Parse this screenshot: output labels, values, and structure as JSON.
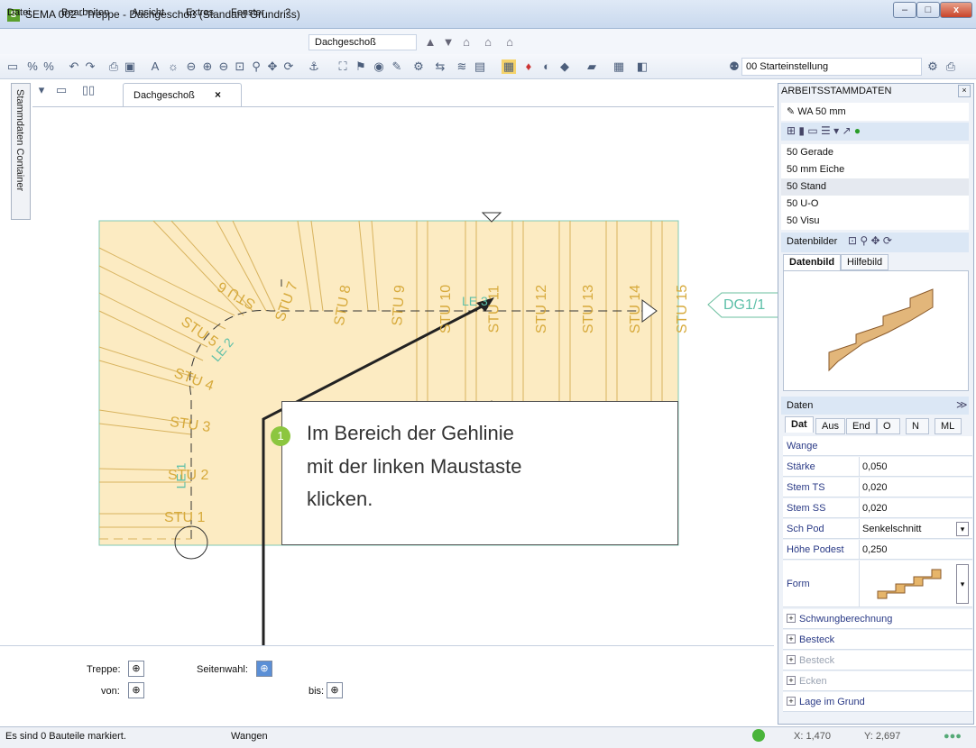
{
  "window": {
    "title": "SEMA  002 - Treppe  - Dachgeschoß (Standard Grundriss)",
    "logo": "S"
  },
  "menu": {
    "items": [
      "Datei",
      "Bearbeiten",
      "Ansicht",
      "Extras",
      "Fenster",
      "?"
    ],
    "level": "Dachgeschoß"
  },
  "toolbar": {
    "preset": "00 Starteinstellung"
  },
  "side_container": "Stammdaten Container",
  "document_tab": "Dachgeschoß",
  "drawing": {
    "steps": [
      "STU 1",
      "STU 2",
      "STU 3",
      "STU 4",
      "STU 5",
      "STU 6",
      "STU 7",
      "STU 8",
      "STU 9",
      "STU 10",
      "STU 11",
      "STU 12",
      "STU 13",
      "STU 14",
      "STU 15"
    ],
    "walk_lines": [
      "LE 1",
      "LE 2",
      "LE 3"
    ],
    "exit_label": "DG1/1"
  },
  "callout": {
    "number": "1",
    "text_lines": [
      "Im Bereich der Gehlinie",
      "mit der linken Maustaste",
      "klicken."
    ]
  },
  "panel": {
    "title": "ARBEITSSTAMMDATEN",
    "material": "WA 50 mm",
    "list": [
      "50 Gerade",
      "50 mm Eiche",
      "50 Stand",
      "50 U-O",
      "50 Visu"
    ],
    "images_title": "Datenbilder",
    "image_tabs": [
      "Datenbild",
      "Hilfebild"
    ],
    "data_title": "Daten",
    "data_tabs": [
      "Dat",
      "Aus",
      "End",
      "O",
      "N",
      "ML"
    ],
    "section": "Wange",
    "props": [
      {
        "k": "Stärke",
        "v": "0,050"
      },
      {
        "k": "Stem TS",
        "v": "0,020"
      },
      {
        "k": "Stem SS",
        "v": "0,020"
      },
      {
        "k": "Sch Pod",
        "v": "Senkelschnitt"
      },
      {
        "k": "Höhe Podest",
        "v": "0,250"
      }
    ],
    "form_label": "Form",
    "groups": [
      {
        "label": "Schwungberechnung",
        "disabled": false
      },
      {
        "label": "Besteck",
        "disabled": false
      },
      {
        "label": "Besteck",
        "disabled": true
      },
      {
        "label": "Ecken",
        "disabled": true
      },
      {
        "label": "Lage im Grund",
        "disabled": false
      }
    ]
  },
  "bottom": {
    "treppe": "Treppe:",
    "von": "von:",
    "seitenwahl": "Seitenwahl:",
    "bis": "bis:"
  },
  "status": {
    "message": "Es sind 0 Bauteile markiert.",
    "mode": "Wangen",
    "x": "X: 1,470",
    "y": "Y: 2,697"
  }
}
